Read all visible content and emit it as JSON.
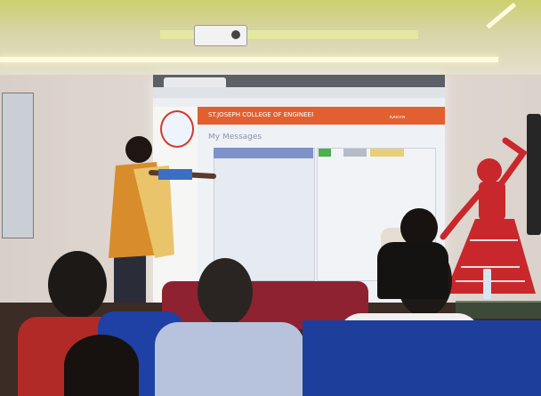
{
  "screen": {
    "college_title": "ST.JOSEPH COLLEGE OF ENGINEERING",
    "page_heading": "My Messages",
    "user_name": "KAVIYA"
  },
  "colors": {
    "ceiling": "#cfcf8a",
    "wall": "#d9d0c8",
    "projection": "#eef1f6",
    "portal_header": "#e2602f",
    "dancer": "#c8282c",
    "chairs": "#1e3e9c"
  }
}
